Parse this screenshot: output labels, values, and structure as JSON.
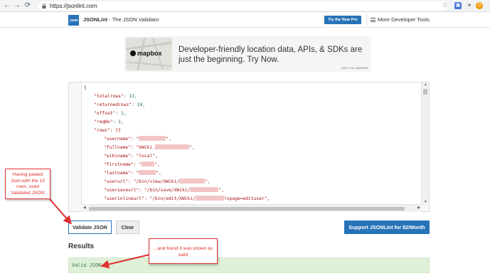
{
  "browser": {
    "url": "https://jsonlint.com",
    "profile_initial": "D"
  },
  "header": {
    "logo_text": "JSON",
    "brand": "JSONLint",
    "tagline": " - The JSON Validator",
    "pro_button": "Try the New Pro",
    "more_tools": "More Developer Tools"
  },
  "ad": {
    "brand": "mapbox",
    "text": "Developer-friendly location data, APIs, & SDKs are just the beginning. Try Now.",
    "via": "ADS VIA CARBON"
  },
  "editor": {
    "line_numbers": [
      "1",
      "2",
      "3",
      "4",
      "5",
      "6",
      "7",
      "8",
      "9",
      "10",
      "11",
      "12",
      "13",
      "14",
      "15"
    ],
    "lines": [
      {
        "key": "{",
        "value": ""
      },
      {
        "key": "\"totalrows\"",
        "value": ": 13,"
      },
      {
        "key": "\"returnedrows\"",
        "value": ": 10,"
      },
      {
        "key": "\"offset\"",
        "value": ": 1,"
      },
      {
        "key": "\"reqNo\"",
        "value": ": 1,"
      },
      {
        "key": "\"rows\"",
        "value": ": [{"
      },
      {
        "key": "\"username\"",
        "value": ": \""
      },
      {
        "key": "\"fullname\"",
        "value": ": \"XWiki."
      },
      {
        "key": "\"wikiname\"",
        "value": ": \"local\","
      },
      {
        "key": "\"firstname\"",
        "value": ": \""
      },
      {
        "key": "\"lastname\"",
        "value": ": \""
      },
      {
        "key": "\"userurl\"",
        "value": ": \"/bin/view/XWiki/"
      },
      {
        "key": "\"usersaveurl\"",
        "value": ": \"/bin/save/XWiki/"
      },
      {
        "key": "\"userinlineurl\"",
        "value": ": \"/bin/edit/XWiki/"
      },
      {
        "key": "",
        "value": ""
      }
    ],
    "suffix_editinline": "?xpage=edituser\","
  },
  "buttons": {
    "validate": "Validate JSON",
    "clear": "Clear",
    "support": "Support JSONLint for $2/Month"
  },
  "results": {
    "heading": "Results",
    "message": "Valid JSON"
  },
  "annotations": {
    "callout1": "Having pasted Json with the 13 rows, used 'Validated JSON'",
    "callout2": "...and found it was shown as valid"
  },
  "colors": {
    "accent": "#2773b8",
    "success_bg": "#dff0d8",
    "annotation_red": "#e03030"
  }
}
